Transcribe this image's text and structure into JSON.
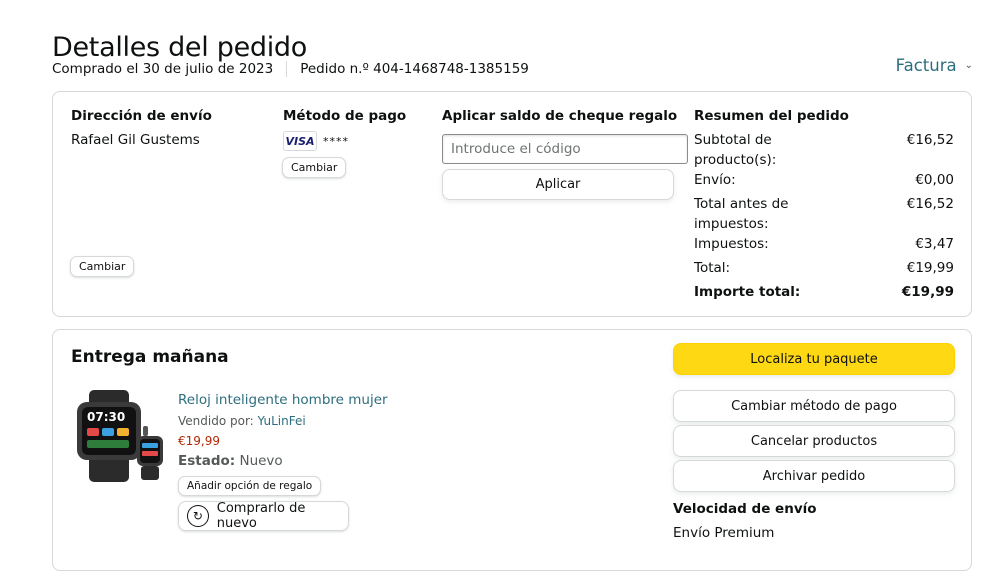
{
  "header": {
    "title": "Detalles del pedido",
    "purchased": "Comprado el 30 de julio de 2023",
    "order_number": "Pedido n.º 404-1468748-1385159",
    "invoice_label": "Factura",
    "invoice_icon": "chevron-down-icon"
  },
  "shipping": {
    "heading": "Dirección de envío",
    "name": "Rafael Gil Gustems",
    "change_label": "Cambiar"
  },
  "payment": {
    "heading": "Método de pago",
    "card_brand": "VISA",
    "card_masked": "****",
    "change_label": "Cambiar"
  },
  "gift": {
    "heading": "Aplicar saldo de cheque regalo",
    "placeholder": "Introduce el código",
    "apply_label": "Aplicar"
  },
  "summary": {
    "heading": "Resumen del pedido",
    "rows": [
      {
        "label": "Subtotal de producto(s):",
        "value": "€16,52"
      },
      {
        "label": "Envío:",
        "value": "€0,00"
      },
      {
        "label": "Total antes de impuestos:",
        "value": "€16,52"
      },
      {
        "label": "Impuestos:",
        "value": "€3,47"
      },
      {
        "label": "Total:",
        "value": "€19,99"
      },
      {
        "label": "Importe total:",
        "value": "€19,99"
      }
    ]
  },
  "delivery": {
    "title": "Entrega mañana",
    "product": {
      "name": "Reloj inteligente hombre mujer",
      "sold_by_label": "Vendido por:",
      "seller": "YuLinFei",
      "price": "€19,99",
      "condition_label": "Estado:",
      "condition": "Nuevo",
      "gift_option_label": "Añadir opción de regalo",
      "buy_again_label": "Comprarlo de nuevo",
      "watch_time": "07:30"
    },
    "actions": {
      "track": "Localiza tu paquete",
      "change_payment": "Cambiar método de pago",
      "cancel": "Cancelar productos",
      "archive": "Archivar pedido"
    },
    "speed": {
      "heading": "Velocidad de envío",
      "value": "Envío Premium"
    }
  },
  "colors": {
    "link": "#2d6e7e",
    "price": "#b12704",
    "primary_button": "#ffd814",
    "border": "#d5d9d9"
  }
}
